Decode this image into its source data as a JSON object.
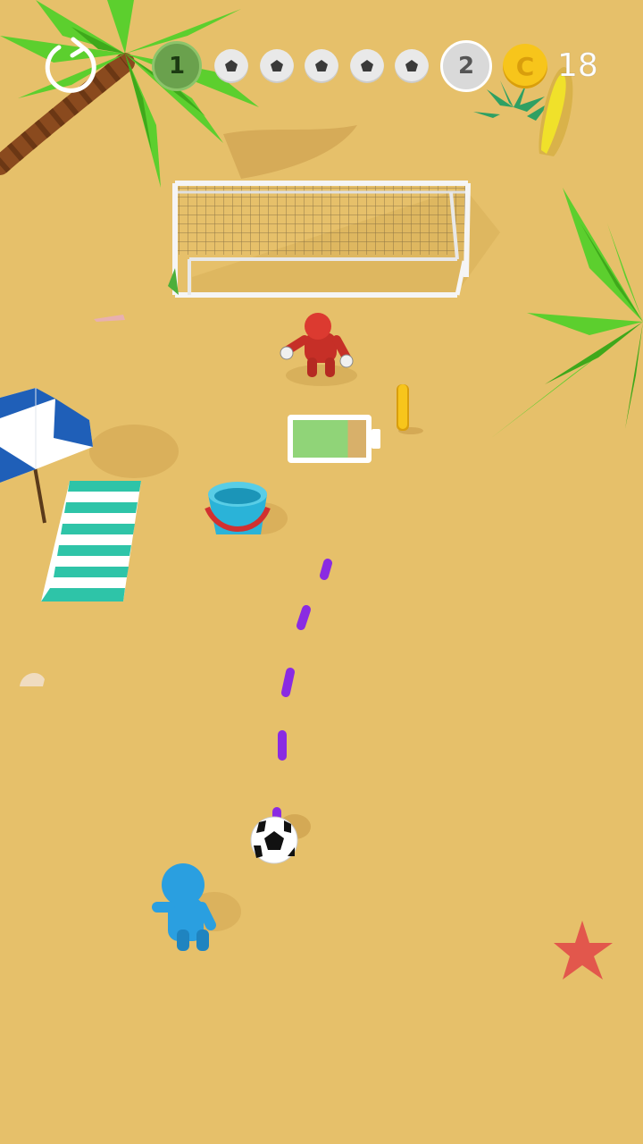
{
  "hud": {
    "levels": [
      {
        "label": "1",
        "state": "completed"
      },
      {
        "label": "2",
        "state": "next"
      }
    ],
    "stages_total": 5,
    "stages_completed": 0,
    "coin_symbol": "C",
    "coins": "18"
  },
  "goalkeeper": {
    "energy_fraction": 0.75
  },
  "colors": {
    "sand": "#e6c06a",
    "player": "#2a9fe0",
    "goalkeeper": "#d9322a",
    "aim_line": "#8a2be2",
    "coin": "#f7c51b",
    "energy": "#90d478"
  },
  "icons": [
    "restart-icon",
    "soccer-ball-icon",
    "coin-icon"
  ]
}
